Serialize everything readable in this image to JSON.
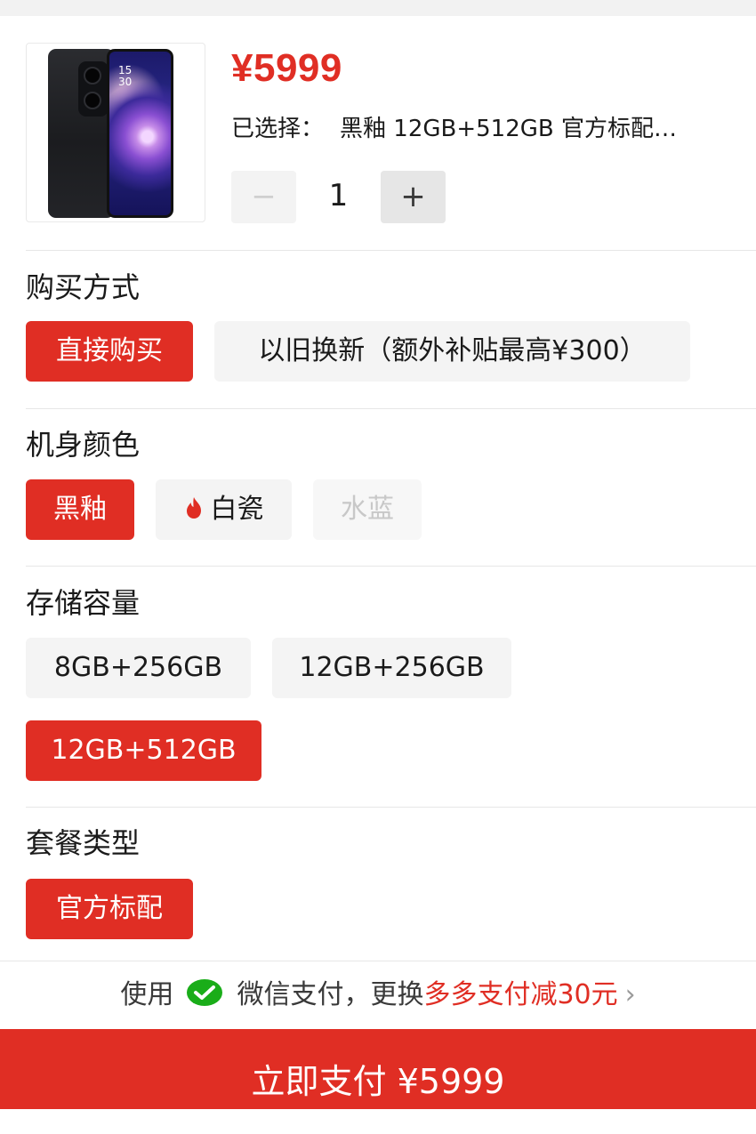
{
  "product": {
    "price": "¥5999",
    "selected_label": "已选择：",
    "selected_value": "黑釉 12GB+512GB 官方标配…",
    "image_clock": "15\n30",
    "quantity": "1",
    "minus_label": "−",
    "plus_label": "+"
  },
  "sections": {
    "purchase": {
      "title": "购买方式",
      "options": [
        {
          "label": "直接购买",
          "state": "selected"
        },
        {
          "label": "以旧换新（额外补贴最高¥300）",
          "state": "normal"
        }
      ]
    },
    "color": {
      "title": "机身颜色",
      "options": [
        {
          "label": "黑釉",
          "state": "selected"
        },
        {
          "label": "白瓷",
          "state": "normal",
          "icon": "flame-icon"
        },
        {
          "label": "水蓝",
          "state": "disabled"
        }
      ]
    },
    "storage": {
      "title": "存储容量",
      "options": [
        {
          "label": "8GB+256GB",
          "state": "normal"
        },
        {
          "label": "12GB+256GB",
          "state": "normal"
        },
        {
          "label": "12GB+512GB",
          "state": "selected"
        }
      ]
    },
    "package": {
      "title": "套餐类型",
      "options": [
        {
          "label": "官方标配",
          "state": "selected"
        }
      ]
    }
  },
  "payment": {
    "prefix": "使用",
    "method": "微信支付，更换",
    "promo": "多多支付减30元",
    "chevron": "›",
    "icon": "wechat-pay-icon"
  },
  "pay_button": "立即支付 ¥5999",
  "colors": {
    "accent": "#e02e24",
    "chip_bg": "#f4f4f4",
    "wechat_green": "#1aad19"
  }
}
